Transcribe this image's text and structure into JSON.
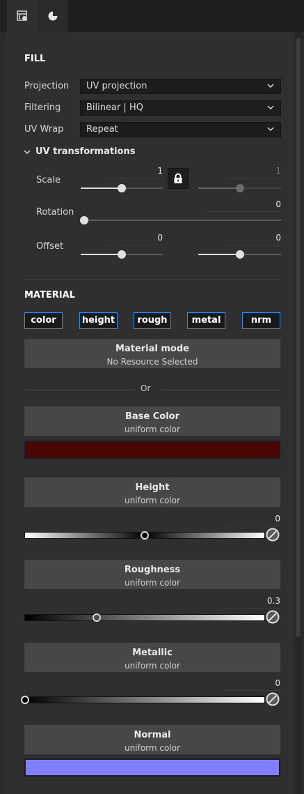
{
  "tabs": [
    {
      "icon": "layer-properties-icon"
    },
    {
      "icon": "material-ball-icon"
    }
  ],
  "fill": {
    "title": "FILL",
    "projection": {
      "label": "Projection",
      "value": "UV projection"
    },
    "filtering": {
      "label": "Filtering",
      "value": "Bilinear | HQ"
    },
    "uv_wrap": {
      "label": "UV Wrap",
      "value": "Repeat"
    },
    "uv_transformations": {
      "title": "UV transformations",
      "expanded": true,
      "scale": {
        "label": "Scale",
        "value_left": "1",
        "value_right": "1",
        "left_fraction": 0.5,
        "right_fraction": 0.5,
        "locked": true
      },
      "rotation": {
        "label": "Rotation",
        "value": "0",
        "fraction": 0.0
      },
      "offset": {
        "label": "Offset",
        "value_left": "0",
        "value_right": "0",
        "left_fraction": 0.5,
        "right_fraction": 0.5
      }
    }
  },
  "material": {
    "title": "MATERIAL",
    "channels": [
      "color",
      "height",
      "rough",
      "metal",
      "nrm"
    ],
    "mode": {
      "title": "Material mode",
      "subtitle": "No Resource Selected"
    },
    "or_label": "Or",
    "base_color": {
      "title": "Base Color",
      "subtitle": "uniform color",
      "color": "#4a0505"
    },
    "height": {
      "title": "Height",
      "subtitle": "uniform color",
      "value": "0",
      "fraction": 0.5
    },
    "roughness": {
      "title": "Roughness",
      "subtitle": "uniform color",
      "value": "0.3",
      "fraction": 0.3
    },
    "metallic": {
      "title": "Metallic",
      "subtitle": "uniform color",
      "value": "0",
      "fraction": 0.0
    },
    "normal": {
      "title": "Normal",
      "subtitle": "uniform color",
      "color": "#7f7fff"
    }
  },
  "colors": {
    "accent": "#2f8df1",
    "panel": "#2f2f2f"
  }
}
